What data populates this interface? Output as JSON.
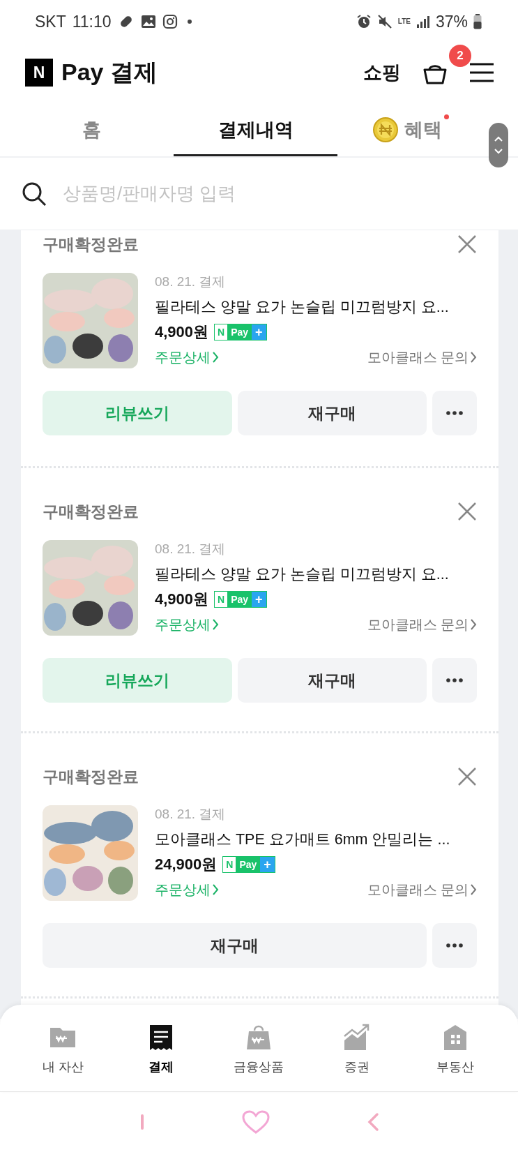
{
  "status_bar": {
    "carrier": "SKT",
    "time": "11:10",
    "network": "LTE",
    "battery": "37%"
  },
  "header": {
    "logo": "N",
    "title": "Pay 결제",
    "shopping": "쇼핑",
    "cart_count": "2"
  },
  "tabs": [
    {
      "label": "홈",
      "selected": false,
      "new": false
    },
    {
      "label": "결제내역",
      "selected": true,
      "new": false
    },
    {
      "label": "혜택",
      "selected": false,
      "new": true
    }
  ],
  "search": {
    "placeholder": "상품명/판매자명 입력"
  },
  "orders": [
    {
      "status": "구매확정완료",
      "date": "08. 21. 결제",
      "name": "필라테스 양말 요가 논슬립 미끄럼방지 요...",
      "price": "4,900원",
      "pay_badge": {
        "n": "N",
        "label": "Pay",
        "plus": "+"
      },
      "detail_link": "주문상세",
      "seller_link": "모아클래스 문의",
      "buttons": [
        {
          "label": "리뷰쓰기",
          "kind": "primary"
        },
        {
          "label": "재구매",
          "kind": "secondary"
        }
      ]
    },
    {
      "status": "구매확정완료",
      "date": "08. 21. 결제",
      "name": "필라테스 양말 요가 논슬립 미끄럼방지 요...",
      "price": "4,900원",
      "pay_badge": {
        "n": "N",
        "label": "Pay",
        "plus": "+"
      },
      "detail_link": "주문상세",
      "seller_link": "모아클래스 문의",
      "buttons": [
        {
          "label": "리뷰쓰기",
          "kind": "primary"
        },
        {
          "label": "재구매",
          "kind": "secondary"
        }
      ]
    },
    {
      "status": "구매확정완료",
      "date": "08. 21. 결제",
      "name": "모아클래스 TPE 요가매트 6mm 안밀리는 ...",
      "price": "24,900원",
      "pay_badge": {
        "n": "N",
        "label": "Pay",
        "plus": "+"
      },
      "detail_link": "주문상세",
      "seller_link": "모아클래스 문의",
      "buttons": [
        {
          "label": "재구매",
          "kind": "secondary"
        }
      ]
    }
  ],
  "bottom_nav": [
    {
      "label": "내 자산",
      "selected": false
    },
    {
      "label": "결제",
      "selected": true
    },
    {
      "label": "금융상품",
      "selected": false
    },
    {
      "label": "증권",
      "selected": false
    },
    {
      "label": "부동산",
      "selected": false
    }
  ]
}
